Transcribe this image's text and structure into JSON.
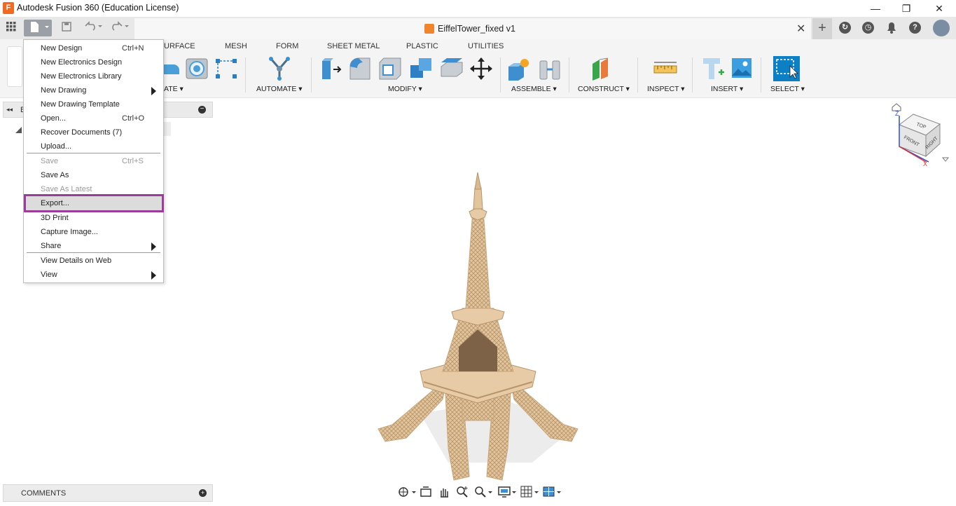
{
  "window": {
    "title": "Autodesk Fusion 360 (Education License)",
    "logo_letter": "F",
    "minimize": "—",
    "restore": "❐",
    "close": "✕"
  },
  "tabs": {
    "document_title": "EiffelTower_fixed v1",
    "close": "✕",
    "new_tab": "+"
  },
  "workspace_tabs": [
    "URFACE",
    "MESH",
    "FORM",
    "SHEET METAL",
    "PLASTIC",
    "UTILITIES"
  ],
  "toolbar_groups": {
    "create": "ATE ▾",
    "automate": "AUTOMATE ▾",
    "modify": "MODIFY ▾",
    "assemble": "ASSEMBLE ▾",
    "construct": "CONSTRUCT ▾",
    "inspect": "INSPECT ▾",
    "insert": "INSERT ▾",
    "select": "SELECT ▾"
  },
  "file_menu": {
    "items": [
      {
        "label": "New Design",
        "shortcut": "Ctrl+N"
      },
      {
        "label": "New Electronics Design",
        "shortcut": ""
      },
      {
        "label": "New Electronics Library",
        "shortcut": ""
      },
      {
        "label": "New Drawing",
        "shortcut": ""
      },
      {
        "label": "New Drawing Template",
        "shortcut": ""
      },
      {
        "label": "Open...",
        "shortcut": "Ctrl+O"
      },
      {
        "label": "Recover Documents (7)",
        "shortcut": ""
      },
      {
        "label": "Upload...",
        "shortcut": ""
      },
      {
        "label": "Save",
        "shortcut": "Ctrl+S"
      },
      {
        "label": "Save As",
        "shortcut": ""
      },
      {
        "label": "Save As Latest",
        "shortcut": ""
      },
      {
        "label": "Export...",
        "shortcut": ""
      },
      {
        "label": "3D Print",
        "shortcut": ""
      },
      {
        "label": "Capture Image...",
        "shortcut": ""
      },
      {
        "label": "Share",
        "shortcut": ""
      },
      {
        "label": "View Details on Web",
        "shortcut": ""
      },
      {
        "label": "View",
        "shortcut": ""
      }
    ]
  },
  "browser": {
    "collapse": "◂◂",
    "label_fragment": "B",
    "minus": "−"
  },
  "comments": {
    "label": "COMMENTS",
    "add": "+"
  },
  "viewcube": {
    "top": "TOP",
    "front": "FRONT",
    "right": "RIGHT",
    "axis_z": "Z",
    "axis_x": "X"
  },
  "colors": {
    "accent_highlight": "#9b3b9a",
    "select_blue": "#0d7fc4",
    "tower": "#e2c59d"
  }
}
